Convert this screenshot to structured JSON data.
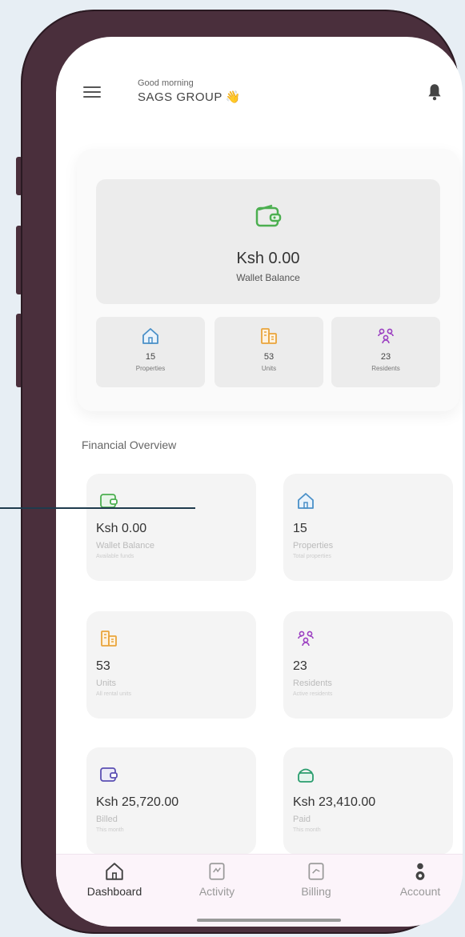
{
  "header": {
    "greeting": "Good morning",
    "company": "SAGS GROUP",
    "wave_emoji": "👋"
  },
  "hero": {
    "wallet_amount": "Ksh 0.00",
    "wallet_label": "Wallet Balance",
    "stats": [
      {
        "value": "15",
        "label": "Properties",
        "icon": "home-icon"
      },
      {
        "value": "53",
        "label": "Units",
        "icon": "units-icon"
      },
      {
        "value": "23",
        "label": "Residents",
        "icon": "residents-icon"
      }
    ]
  },
  "financial_overview": {
    "title": "Financial Overview",
    "tiles": [
      {
        "value": "Ksh 0.00",
        "label": "Wallet Balance",
        "sub": "Available funds",
        "icon": "wallet-icon",
        "color": "#4caf50"
      },
      {
        "value": "15",
        "label": "Properties",
        "sub": "Total properties",
        "icon": "home-icon",
        "color": "#4a90c8"
      },
      {
        "value": "53",
        "label": "Units",
        "sub": "All rental units",
        "icon": "units-icon",
        "color": "#e9a43b"
      },
      {
        "value": "23",
        "label": "Residents",
        "sub": "Active residents",
        "icon": "residents-icon",
        "color": "#9b3fc1"
      },
      {
        "value": "Ksh 25,720.00",
        "label": "Billed",
        "sub": "This month",
        "icon": "billed-icon",
        "color": "#5b4fb3"
      },
      {
        "value": "Ksh 23,410.00",
        "label": "Paid",
        "sub": "This month",
        "icon": "paid-icon",
        "color": "#2a9d6e"
      }
    ]
  },
  "bottom_nav": [
    {
      "label": "Dashboard",
      "active": true,
      "icon": "home-icon"
    },
    {
      "label": "Activity",
      "active": false,
      "icon": "activity-icon"
    },
    {
      "label": "Billing",
      "active": false,
      "icon": "billing-icon"
    },
    {
      "label": "Account",
      "active": false,
      "icon": "account-icon"
    }
  ],
  "colors": {
    "wallet_green": "#4caf50",
    "home_blue": "#4a90c8",
    "units_orange": "#e9a43b",
    "residents_purple": "#9b3fc1",
    "phone_frame": "#4a2f3c"
  }
}
